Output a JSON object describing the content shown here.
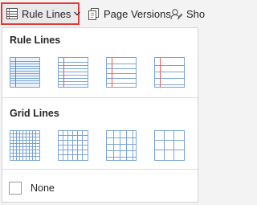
{
  "toolbar": {
    "rule_lines_label": "Rule Lines",
    "page_versions_label": "Page Versions",
    "show_label": "Sho"
  },
  "panel": {
    "rule_lines_heading": "Rule Lines",
    "grid_lines_heading": "Grid Lines",
    "none_label": "None",
    "rule_options": [
      {
        "name": "narrow-ruled",
        "spacing": "narrow",
        "margin": true
      },
      {
        "name": "college-ruled",
        "spacing": "college",
        "margin": true
      },
      {
        "name": "standard-ruled",
        "spacing": "standard",
        "margin": true
      },
      {
        "name": "wide-ruled",
        "spacing": "wide",
        "margin": true
      }
    ],
    "grid_options": [
      {
        "name": "small-grid",
        "spacing": "small"
      },
      {
        "name": "medium-grid",
        "spacing": "medium"
      },
      {
        "name": "large-grid",
        "spacing": "large"
      },
      {
        "name": "very-large-grid",
        "spacing": "very-large"
      }
    ]
  },
  "colors": {
    "highlight_border": "#e03a3a",
    "line_blue": "#7aa4d6",
    "margin_red": "#e05a5a"
  }
}
